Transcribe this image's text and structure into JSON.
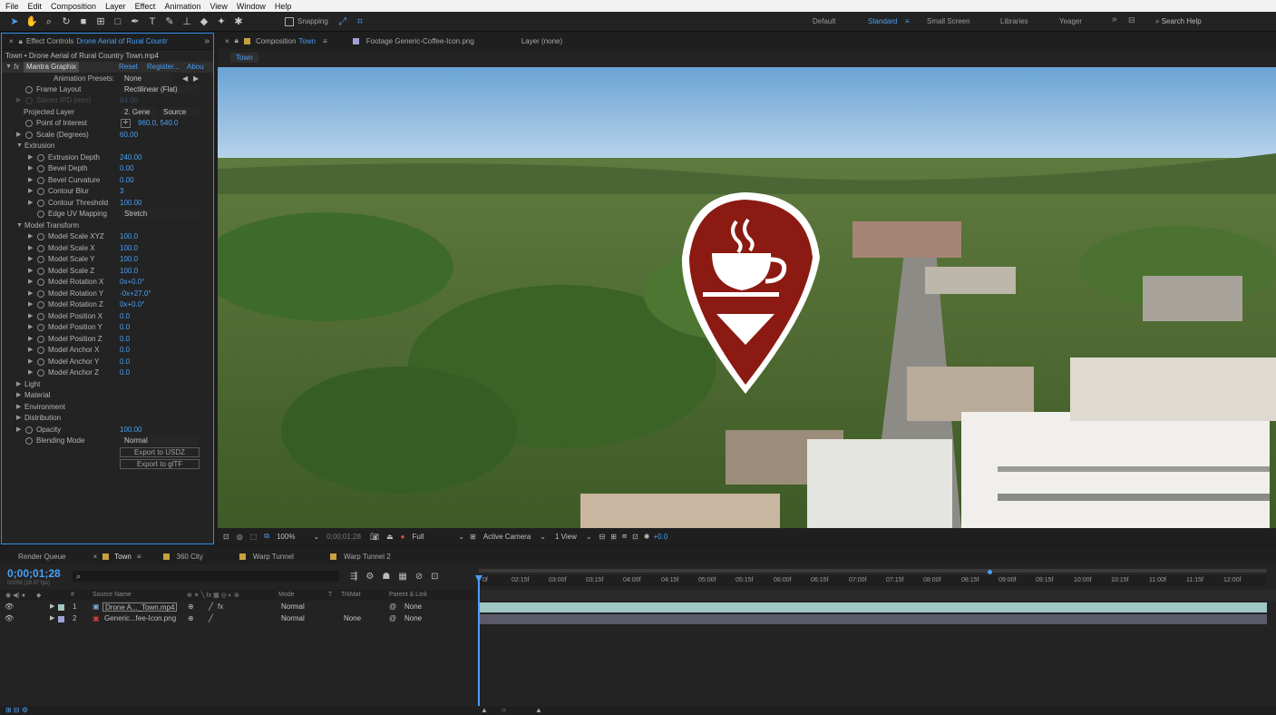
{
  "menu": [
    "File",
    "Edit",
    "Composition",
    "Layer",
    "Effect",
    "Animation",
    "View",
    "Window",
    "Help"
  ],
  "toolbar": {
    "snapping_label": "Snapping",
    "workspaces": [
      "Default",
      "Standard",
      "Small Screen",
      "Libraries",
      "Yeager"
    ],
    "active_workspace": "Standard",
    "search_placeholder": "Search Help"
  },
  "effect_controls": {
    "tab_prefix": "Effect Controls",
    "tab_layer": "Drone Aerial of Rural Countr",
    "subtitle": "Town • Drone Aerial of Rural Country Town.mp4",
    "effect_name": "Mantra Graphix",
    "reset": "Reset",
    "register": "Register...",
    "about": "Abou",
    "animation_presets_label": "Animation Presets:",
    "animation_presets_value": "None",
    "frame_layout_label": "Frame Layout",
    "frame_layout_value": "Rectilinear (Flat)",
    "stereo_label": "Stereo IPD (mm)",
    "stereo_value": "64.00",
    "projected_layer_label": "Projected Layer",
    "projected_layer_value": "2. Gene",
    "projected_layer_source": "Source",
    "point_of_interest_label": "Point of Interest",
    "point_of_interest_value": "960.0, 540.0",
    "scale_label": "Scale (Degrees)",
    "scale_value": "60.00",
    "extrusion_label": "Extrusion",
    "extrusion_depth_label": "Extrusion Depth",
    "extrusion_depth_value": "240.00",
    "bevel_depth_label": "Bevel Depth",
    "bevel_depth_value": "0.00",
    "bevel_curvature_label": "Bevel Curvature",
    "bevel_curvature_value": "0.00",
    "contour_blur_label": "Contour Blur",
    "contour_blur_value": "3",
    "contour_threshold_label": "Contour Threshold",
    "contour_threshold_value": "100.00",
    "edge_uv_label": "Edge UV Mapping",
    "edge_uv_value": "Stretch",
    "model_transform_label": "Model Transform",
    "model_scale_xyz_label": "Model Scale XYZ",
    "model_scale_xyz_value": "100.0",
    "model_scale_x_label": "Model Scale X",
    "model_scale_x_value": "100.0",
    "model_scale_y_label": "Model Scale Y",
    "model_scale_y_value": "100.0",
    "model_scale_z_label": "Model Scale Z",
    "model_scale_z_value": "100.0",
    "model_rotation_x_label": "Model Rotation X",
    "model_rotation_x_value": "0x+0.0°",
    "model_rotation_y_label": "Model Rotation Y",
    "model_rotation_y_value": "-0x+27.0°",
    "model_rotation_z_label": "Model Rotation Z",
    "model_rotation_z_value": "0x+0.0°",
    "model_position_x_label": "Model Position X",
    "model_position_x_value": "0.0",
    "model_position_y_label": "Model Position Y",
    "model_position_y_value": "0.0",
    "model_position_z_label": "Model Position Z",
    "model_position_z_value": "0.0",
    "model_anchor_x_label": "Model Anchor X",
    "model_anchor_x_value": "0.0",
    "model_anchor_y_label": "Model Anchor Y",
    "model_anchor_y_value": "0.0",
    "model_anchor_z_label": "Model Anchor Z",
    "model_anchor_z_value": "0.0",
    "light_label": "Light",
    "material_label": "Material",
    "environment_label": "Environment",
    "distribution_label": "Distribution",
    "opacity_label": "Opacity",
    "opacity_value": "100.00",
    "blending_mode_label": "Blending Mode",
    "blending_mode_value": "Normal",
    "export_usdz": "Export to USDZ",
    "export_gltf": "Export to glTF"
  },
  "composition": {
    "tab_prefix": "Composition",
    "tab_name": "Town",
    "footage_tab": "Footage Generic-Coffee-Icon.png",
    "layer_tab": "Layer (none)",
    "flowchart_item": "Town",
    "zoom": "100%",
    "timecode": "0;00;01;28",
    "resolution": "Full",
    "camera": "Active Camera",
    "views": "1 View",
    "exposure": "+0.0"
  },
  "timeline": {
    "tabs": [
      "Render Queue",
      "Town",
      "360 City",
      "Warp Tunnel",
      "Warp Tunnel 2"
    ],
    "active_tab": "Town",
    "timecode": "0;00;01;28",
    "frame_info": "00058 (29.97 fps)",
    "columns": [
      "#",
      "Source Name",
      "Mode",
      "T",
      "TrkMat",
      "Parent & Link"
    ],
    "ticks": [
      "0f",
      "02:15f",
      "03:00f",
      "03:15f",
      "04:00f",
      "04:15f",
      "05:00f",
      "05:15f",
      "06:00f",
      "06:15f",
      "07:00f",
      "07:15f",
      "08:00f",
      "08:15f",
      "09:00f",
      "09:15f",
      "10:00f",
      "10:15f",
      "11:00f",
      "11:15f",
      "12:00f"
    ],
    "layers": [
      {
        "num": "1",
        "name": "Drone A..._Town.mp4",
        "mode": "Normal",
        "trkmat": "",
        "parent": "None"
      },
      {
        "num": "2",
        "name": "Generic...fee-Icon.png",
        "mode": "Normal",
        "trkmat": "None",
        "parent": "None"
      }
    ]
  },
  "colors": {
    "accent": "#4a9ff5",
    "icon_red": "#8b1a12",
    "track": "#9fc6c4"
  }
}
